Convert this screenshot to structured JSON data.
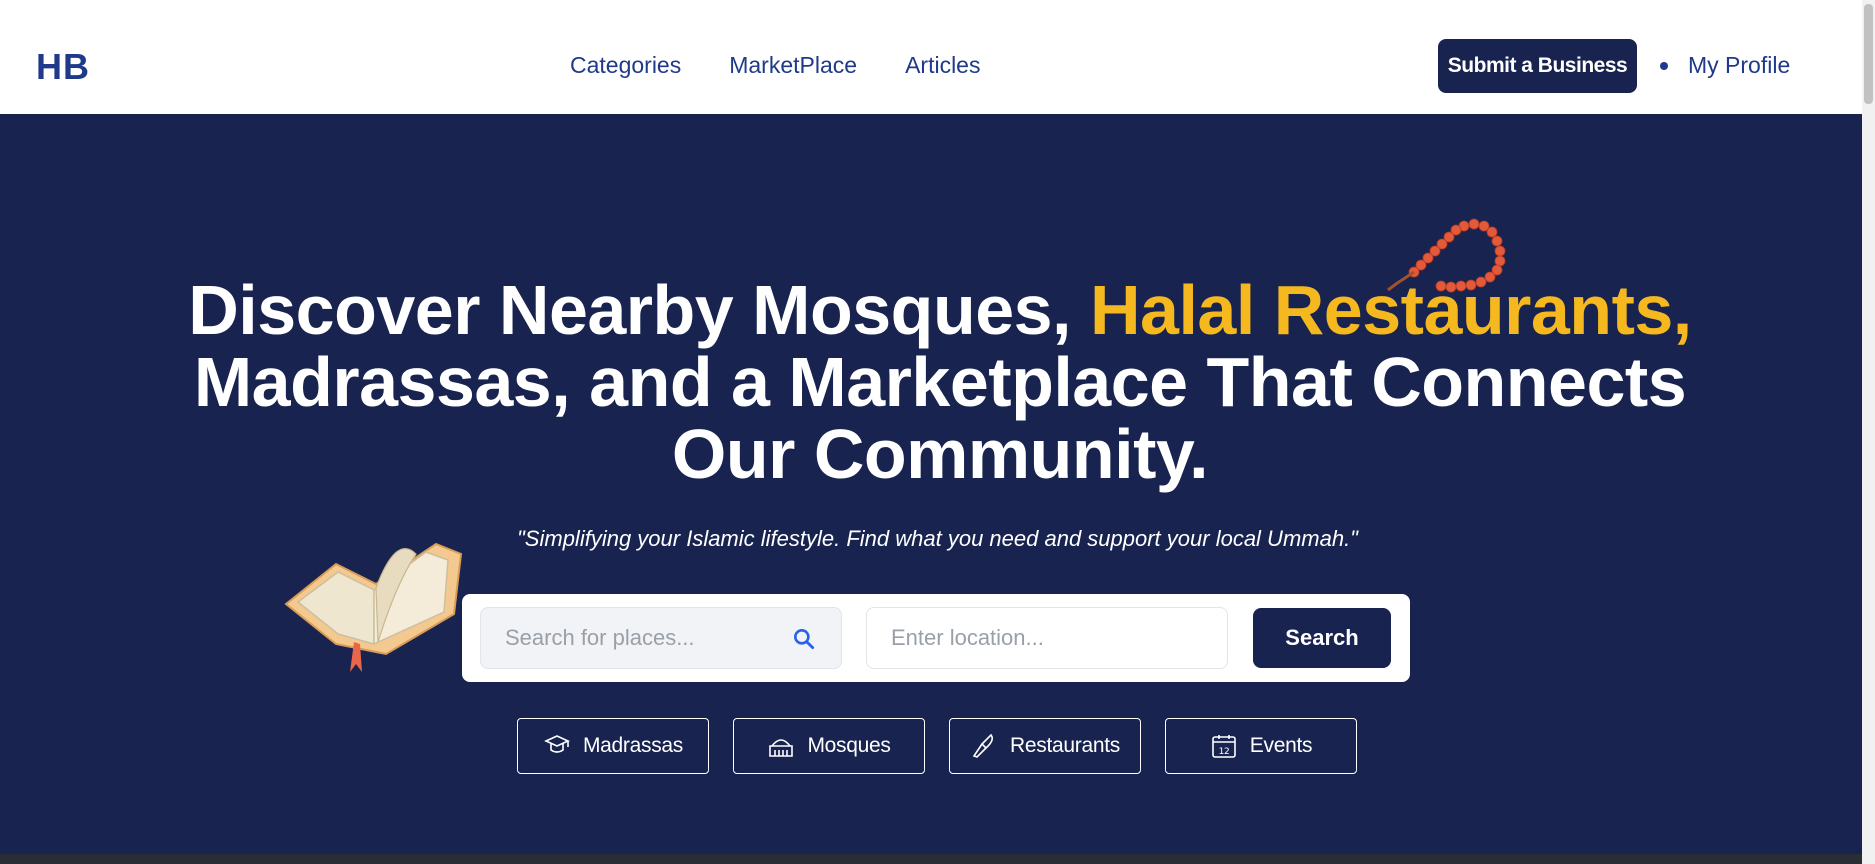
{
  "header": {
    "logo": "HB",
    "nav": [
      "Categories",
      "MarketPlace",
      "Articles"
    ],
    "submit_label": "Submit a Business",
    "profile_label": "My Profile"
  },
  "hero": {
    "headline_white_1": "Discover Nearby Mosques, ",
    "headline_gold": "Halal Restaurants,",
    "headline_white_2": " Madrassas, and a Marketplace That Connects Our Community.",
    "tagline": "\"Simplifying your Islamic lifestyle. Find what you need and support your local Ummah.\""
  },
  "search": {
    "query_placeholder": "Search for places...",
    "location_placeholder": "Enter location...",
    "button_label": "Search"
  },
  "categories": [
    {
      "label": "Madrassas",
      "icon": "graduation-cap-icon"
    },
    {
      "label": "Mosques",
      "icon": "mosque-icon"
    },
    {
      "label": "Restaurants",
      "icon": "knife-icon"
    },
    {
      "label": "Events",
      "icon": "calendar-icon"
    }
  ],
  "calendar_day": "12",
  "colors": {
    "brand_navy": "#18244f",
    "link_blue": "#1f3a8a",
    "highlight_gold": "#f5b81f"
  }
}
